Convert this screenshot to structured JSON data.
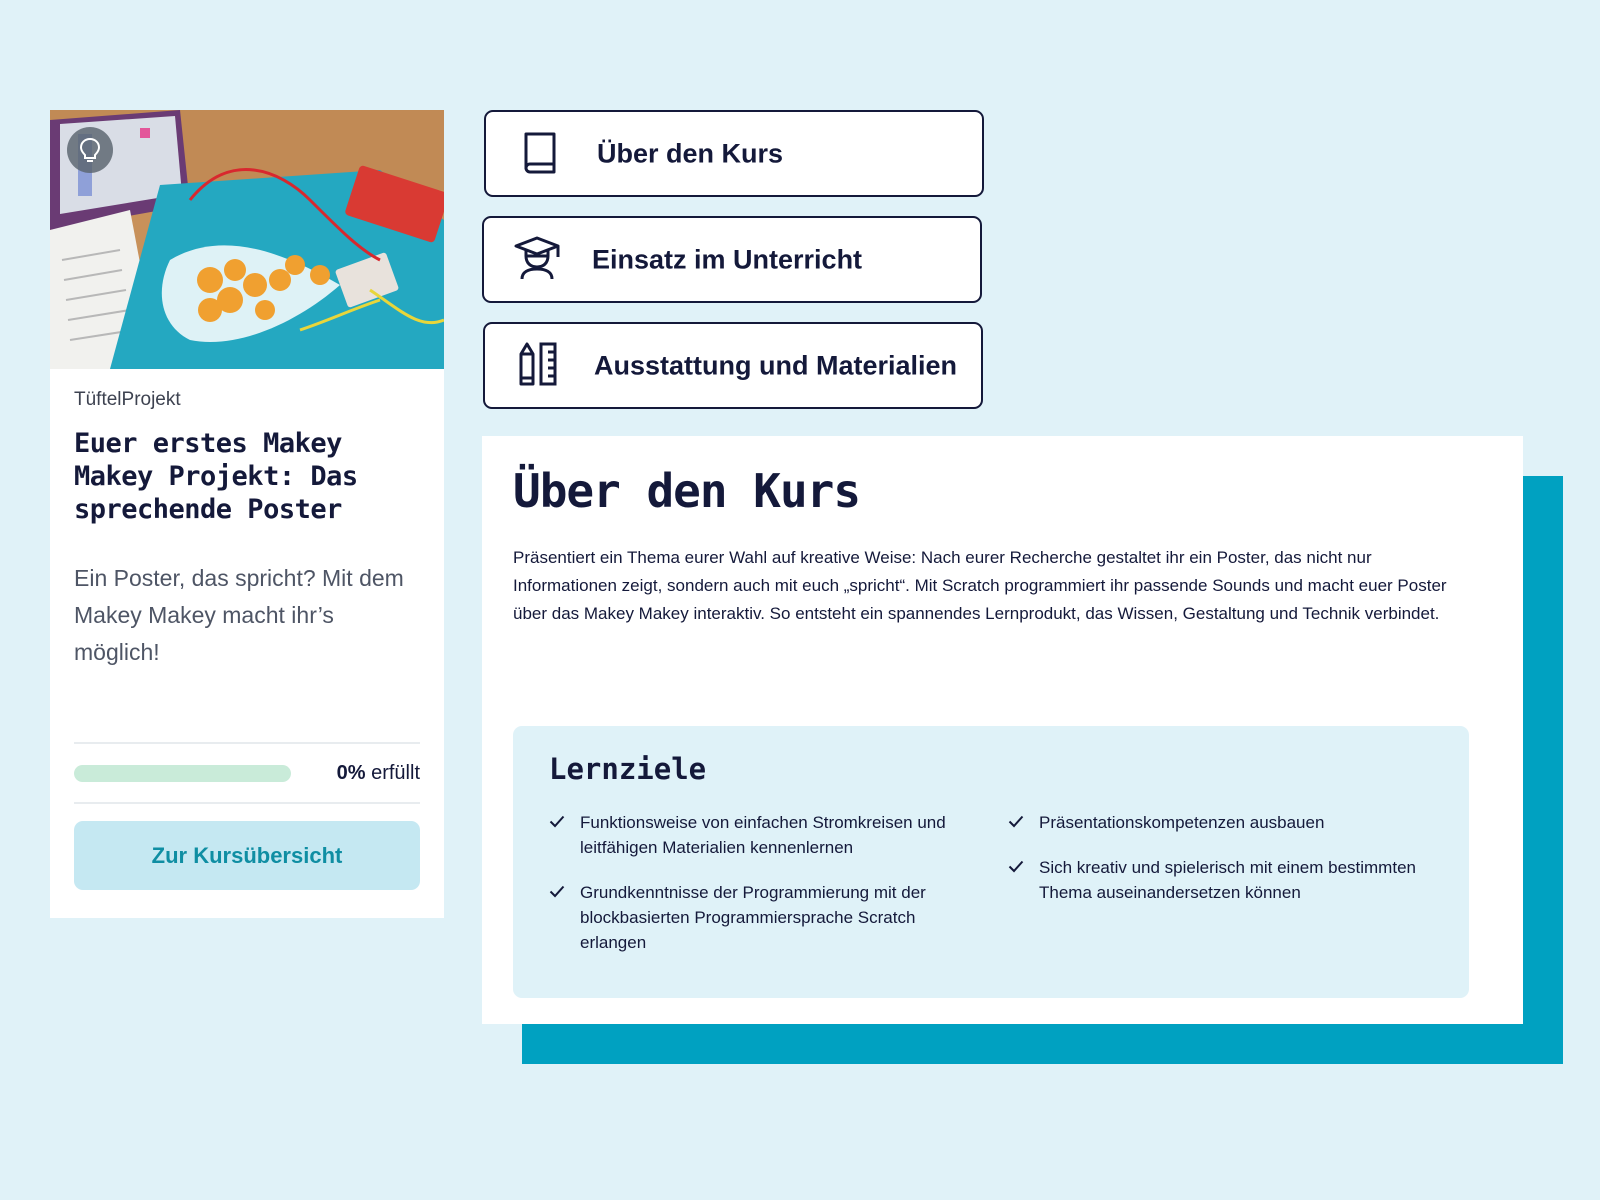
{
  "card": {
    "kicker": "TüftelProjekt",
    "title": "Euer erstes Makey Makey Projekt: Das sprechende Poster",
    "description": "Ein Poster, das spricht? Mit dem Makey Makey macht ihr’s möglich!",
    "progress": {
      "value": 0,
      "percent_label": "0%",
      "suffix_label": "erfüllt"
    },
    "button_label": "Zur Kursübersicht",
    "image_icon": "lightbulb-icon"
  },
  "tabs": [
    {
      "label": "Über den Kurs",
      "icon": "book-icon"
    },
    {
      "label": "Einsatz im Unterricht",
      "icon": "graduate-icon"
    },
    {
      "label": "Ausstattung und Materialien",
      "icon": "pencil-ruler-icon"
    }
  ],
  "panel": {
    "title": "Über den Kurs",
    "text": "Präsentiert ein Thema eurer Wahl auf kreative Weise: Nach eurer Recherche gestaltet ihr ein Poster, das nicht nur Informationen zeigt, sondern auch mit euch „spricht“. Mit Scratch programmiert ihr passende Sounds und macht euer Poster über das Makey Makey interaktiv. So entsteht ein spannendes Lernprodukt, das Wissen, Gestaltung und Technik verbindet.",
    "goals": {
      "title": "Lernziele",
      "left": [
        "Funktionsweise von einfachen Stromkreisen und leitfähigen Materialien kennenlernen",
        "Grundkenntnisse der Programmierung mit der blockbasierten Programmiersprache Scratch erlangen"
      ],
      "right": [
        "Präsentationskompetenzen ausbauen",
        "Sich kreativ und spielerisch mit einem bestimmten Thema auseinandersetzen können"
      ]
    }
  },
  "colors": {
    "background": "#e0f2f8",
    "navy": "#14193a",
    "accent_teal": "#00a1c1",
    "button_bg": "#c5e8f2",
    "button_text": "#0f8ea3",
    "progress_track": "#c9ebd9"
  }
}
